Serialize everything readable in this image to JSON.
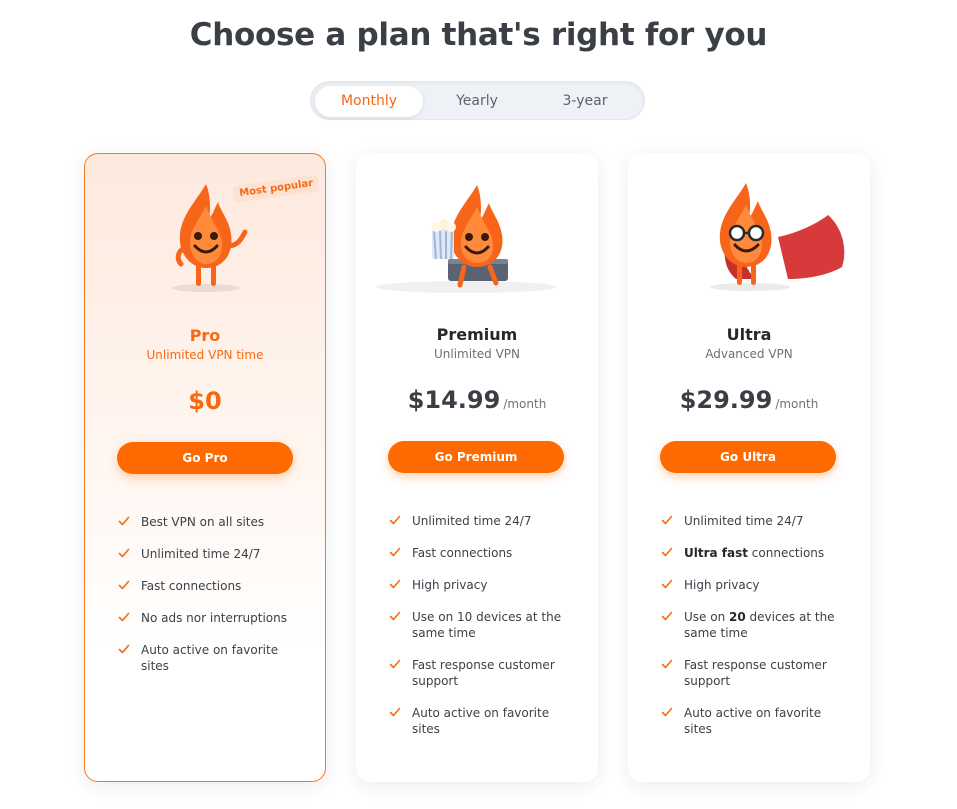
{
  "title": "Choose a plan that's right for you",
  "billing": {
    "options": [
      "Monthly",
      "Yearly",
      "3-year"
    ],
    "selected": "Monthly"
  },
  "colors": {
    "accent": "#ff6a00",
    "accent_text": "#f56a11",
    "featured_border": "#f57a26"
  },
  "plans": [
    {
      "name": "Pro",
      "subtitle": "Unlimited VPN time",
      "price": "$0",
      "period": "",
      "badge": "Most popular",
      "cta": "Go Pro",
      "features": [
        "Best VPN on all sites",
        "Unlimited time 24/7",
        "Fast connections",
        "No ads nor interruptions",
        "Auto active on favorite sites"
      ]
    },
    {
      "name": "Premium",
      "subtitle": "Unlimited VPN",
      "price": "$14.99",
      "period": "/month",
      "cta": "Go Premium",
      "features": [
        "Unlimited time 24/7",
        "Fast connections",
        "High privacy",
        "Use on 10 devices at the same time",
        "Fast response customer support",
        "Auto active on favorite sites"
      ]
    },
    {
      "name": "Ultra",
      "subtitle": "Advanced VPN",
      "price": "$29.99",
      "period": "/month",
      "cta": "Go Ultra",
      "features": [
        {
          "bold": "Ultra fast",
          "rest": " connections",
          "before": ""
        },
        "Unlimited time 24/7",
        "High privacy",
        {
          "before": "Use on ",
          "bold": "20",
          "rest": " devices at the same time"
        },
        "Fast response customer support",
        "Auto active on favorite sites"
      ]
    }
  ]
}
